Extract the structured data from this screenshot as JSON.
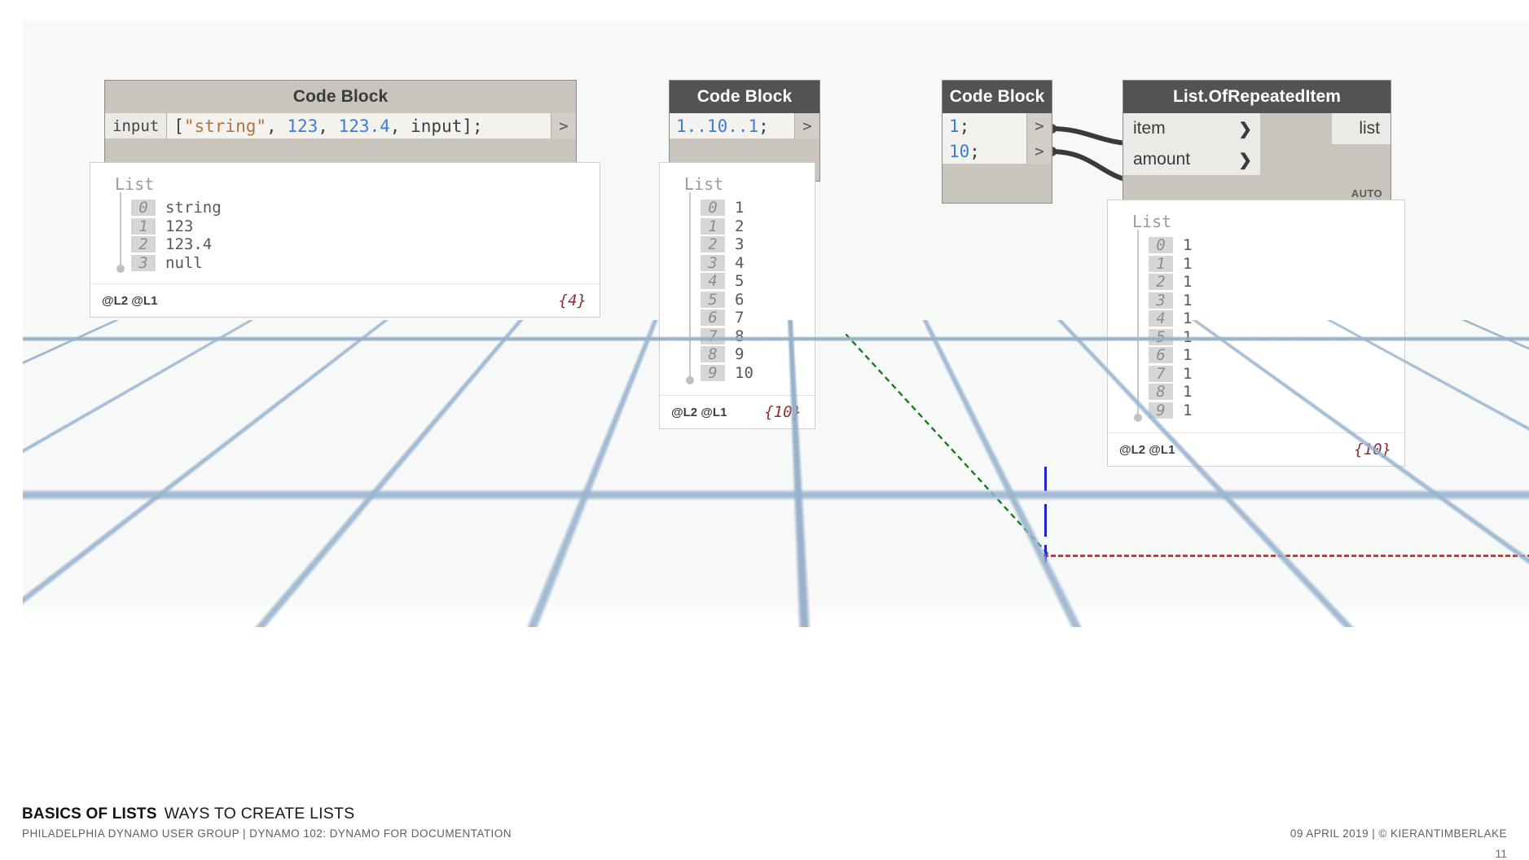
{
  "slide": {
    "footer": {
      "title_bold": "BASICS OF LISTS",
      "title_sub": "WAYS TO CREATE LISTS",
      "meta": "PHILADELPHIA DYNAMO USER GROUP  |  DYNAMO 102:  DYNAMO FOR DOCUMENTATION",
      "right_meta": "09 APRIL 2019  |  © KIERANTIMBERLAKE",
      "page_number": "11"
    }
  },
  "colors": {
    "node_body": "#c9c5bd",
    "node_header_unselected": "#c9c5bd",
    "node_header_selected": "#535353",
    "code_field": "#f3f2ef",
    "port_field": "#eceae6",
    "wire": "#3a3a3a",
    "preview_background": "#ffffff",
    "count_red": "#8a3038",
    "axis_x_red": "#e2312a",
    "axis_y_green": "#1a7a1f",
    "axis_z_blue": "#2222cc",
    "grid_blue": "#96b2cd",
    "string_token": "#b2743c",
    "number_token": "#3a7fd5"
  },
  "nodes": {
    "code_block_1": {
      "title": "Code Block",
      "selected": false,
      "input_port_label": "input",
      "output_port_glyph": ">",
      "code_tokens": [
        {
          "text": "[",
          "type": "pun"
        },
        {
          "text": "\"string\"",
          "type": "str"
        },
        {
          "text": ", ",
          "type": "pun"
        },
        {
          "text": "123",
          "type": "num"
        },
        {
          "text": ", ",
          "type": "pun"
        },
        {
          "text": "123.4",
          "type": "num"
        },
        {
          "text": ", input];",
          "type": "pun"
        }
      ],
      "code_plain": "[\"string\", 123, 123.4, input];"
    },
    "code_block_2": {
      "title": "Code Block",
      "selected": true,
      "output_port_glyph": ">",
      "code_tokens": [
        {
          "text": "1..10..1",
          "type": "num"
        },
        {
          "text": ";",
          "type": "pun"
        }
      ],
      "code_plain": "1..10..1;"
    },
    "code_block_3": {
      "title": "Code Block",
      "selected": true,
      "output_port_glyph": ">",
      "lines": [
        {
          "tokens": [
            {
              "text": "1",
              "type": "num"
            },
            {
              "text": ";",
              "type": "pun"
            }
          ],
          "plain": "1;"
        },
        {
          "tokens": [
            {
              "text": "10",
              "type": "num"
            },
            {
              "text": ";",
              "type": "pun"
            }
          ],
          "plain": "10;"
        }
      ]
    },
    "list_of_repeated_item": {
      "title": "List.OfRepeatedItem",
      "selected": true,
      "inputs": [
        {
          "label": "item",
          "chevron": "❯"
        },
        {
          "label": "amount",
          "chevron": "❯"
        }
      ],
      "output_label": "list",
      "lacing_badge": "AUTO"
    }
  },
  "previews": {
    "preview_1": {
      "title": "List",
      "rows": [
        {
          "index": "0",
          "value": "string"
        },
        {
          "index": "1",
          "value": "123"
        },
        {
          "index": "2",
          "value": "123.4"
        },
        {
          "index": "3",
          "value": "null"
        }
      ],
      "levels": "@L2 @L1",
      "count": "{4}"
    },
    "preview_2": {
      "title": "List",
      "rows": [
        {
          "index": "0",
          "value": "1"
        },
        {
          "index": "1",
          "value": "2"
        },
        {
          "index": "2",
          "value": "3"
        },
        {
          "index": "3",
          "value": "4"
        },
        {
          "index": "4",
          "value": "5"
        },
        {
          "index": "5",
          "value": "6"
        },
        {
          "index": "6",
          "value": "7"
        },
        {
          "index": "7",
          "value": "8"
        },
        {
          "index": "8",
          "value": "9"
        },
        {
          "index": "9",
          "value": "10"
        }
      ],
      "levels": "@L2 @L1",
      "count": "{10}"
    },
    "preview_3": {
      "title": "List",
      "rows": [
        {
          "index": "0",
          "value": "1"
        },
        {
          "index": "1",
          "value": "1"
        },
        {
          "index": "2",
          "value": "1"
        },
        {
          "index": "3",
          "value": "1"
        },
        {
          "index": "4",
          "value": "1"
        },
        {
          "index": "5",
          "value": "1"
        },
        {
          "index": "6",
          "value": "1"
        },
        {
          "index": "7",
          "value": "1"
        },
        {
          "index": "8",
          "value": "1"
        },
        {
          "index": "9",
          "value": "1"
        }
      ],
      "levels": "@L2 @L1",
      "count": "{10}"
    }
  }
}
